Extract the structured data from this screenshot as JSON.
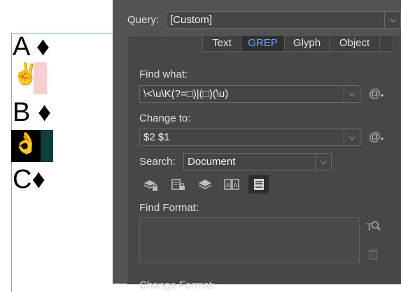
{
  "document": {
    "lines": [
      {
        "text": "A ♦"
      },
      {
        "text": "✌"
      },
      {
        "text": "B ♦"
      },
      {
        "text": "👌"
      },
      {
        "text": "C♦"
      }
    ]
  },
  "dialog": {
    "query_label": "Query:",
    "query_value": "[Custom]",
    "tabs": [
      "Text",
      "GREP",
      "Glyph",
      "Object"
    ],
    "active_tab": "GREP",
    "find_what_label": "Find what:",
    "find_what_value": "\\<\\u\\K(?=□)|(□)(\\u)",
    "change_to_label": "Change to:",
    "change_to_value": "$2 $1",
    "search_label": "Search:",
    "search_value": "Document",
    "find_format_label": "Find Format:",
    "change_format_label": "Change Format:",
    "icons": [
      "include-locked-layers-icon",
      "include-locked-stories-icon",
      "include-hidden-layers-icon",
      "include-master-pages-icon",
      "include-footnotes-icon"
    ]
  }
}
